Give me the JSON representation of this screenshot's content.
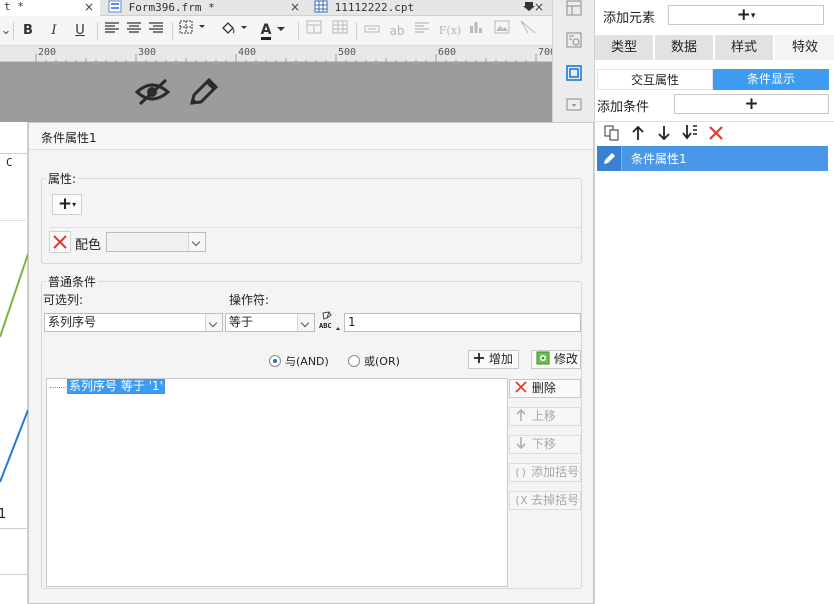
{
  "tabs": [
    {
      "label": "t *",
      "close": "×"
    },
    {
      "label": "Form396.frm *",
      "close": "×"
    },
    {
      "label": "11112222.cpt",
      "close": "×"
    }
  ],
  "toolbar": {
    "bold": "B",
    "italic": "I",
    "underline": "U",
    "font_color": "A",
    "formula": "F(x)",
    "text_ab": "ab"
  },
  "ruler": [
    "200",
    "300",
    "400",
    "500",
    "600",
    "700"
  ],
  "canvas": {
    "col_label": "C",
    "row_label": "⁨1"
  },
  "right_panel": {
    "add_element_label": "添加元素",
    "add_button": "+",
    "main_tabs": [
      "类型",
      "数据",
      "样式",
      "特效"
    ],
    "sub_tabs": [
      "交互属性",
      "条件显示"
    ],
    "add_condition_label": "添加条件",
    "add_condition_button": "+",
    "condition_items": [
      "条件属性1"
    ]
  },
  "dialog": {
    "title": "条件属性1",
    "attr_group_label": "属性:",
    "add_attr_button": "+",
    "attr_rows": [
      {
        "name": "配色",
        "value": ""
      }
    ],
    "common_group_label": "普通条件",
    "column_label": "可选列:",
    "column_value": "系列序号",
    "operator_label": "操作符:",
    "operator_value": "等于",
    "value_type_icon": "ABC",
    "value_input": "1",
    "radio_and": "与(AND)",
    "radio_or": "或(OR)",
    "logic_selected": "AND",
    "add_button": "增加",
    "modify_button": "修改",
    "conditions": [
      "系列序号 等于 '1'"
    ],
    "side_buttons": [
      {
        "label": "删除",
        "enabled": true
      },
      {
        "label": "上移",
        "enabled": false
      },
      {
        "label": "下移",
        "enabled": false
      },
      {
        "label": "添加括号",
        "enabled": false
      },
      {
        "label": "去掉括号",
        "enabled": false
      }
    ]
  },
  "colors": {
    "accent": "#3d9bf0",
    "selection": "#4a97e8",
    "delete_red": "#e03c31"
  }
}
